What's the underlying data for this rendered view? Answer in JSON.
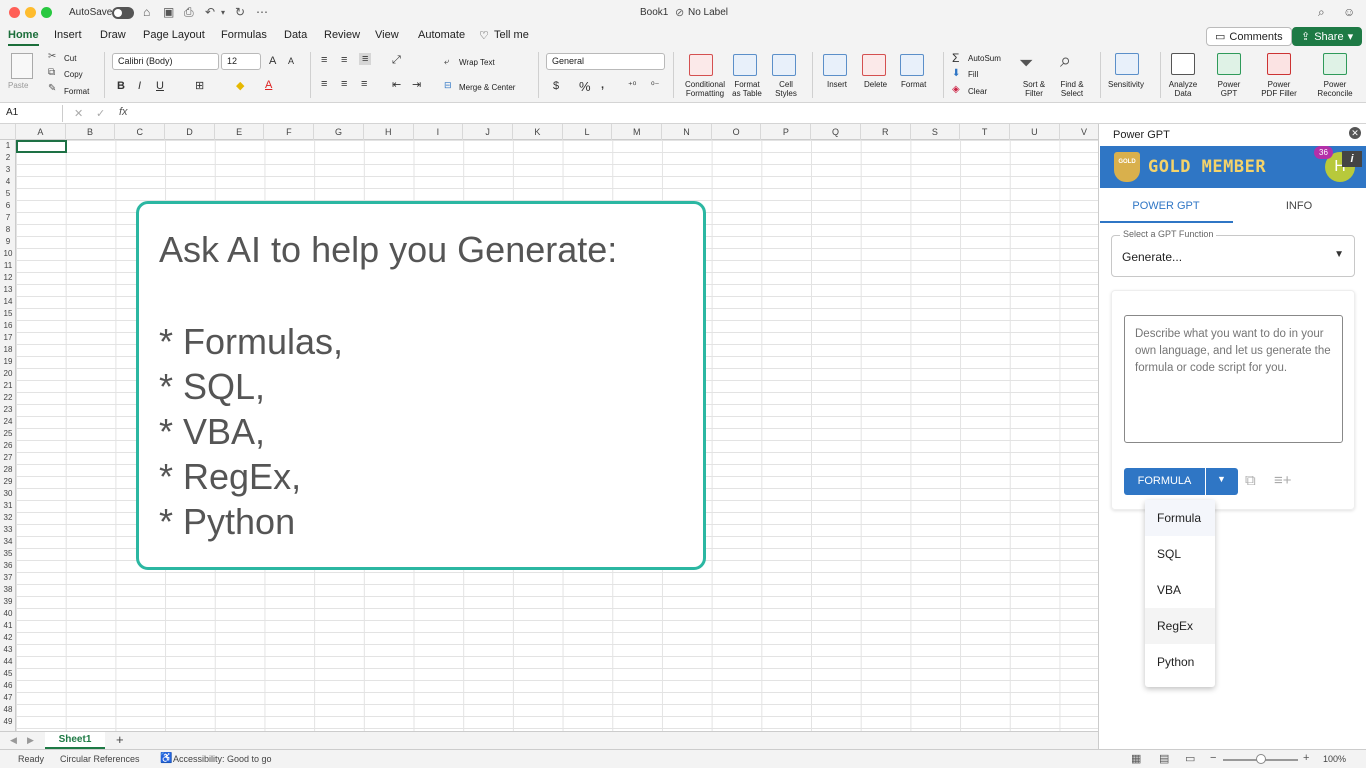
{
  "window": {
    "title": "Book1",
    "label": "No Label",
    "autosave": "AutoSave"
  },
  "colors": {
    "accent_green": "#1b6e3a",
    "brand_blue": "#2f76c5",
    "card_border": "#2bb7a2",
    "gold": "#f4d36a"
  },
  "tabs": [
    {
      "label": "Home"
    },
    {
      "label": "Insert"
    },
    {
      "label": "Draw"
    },
    {
      "label": "Page Layout"
    },
    {
      "label": "Formulas"
    },
    {
      "label": "Data"
    },
    {
      "label": "Review"
    },
    {
      "label": "View"
    },
    {
      "label": "Automate"
    },
    {
      "label": "Tell me"
    }
  ],
  "top_buttons": {
    "comments": "Comments",
    "share": "Share"
  },
  "ribbon": {
    "paste": "Paste",
    "cut": "Cut",
    "copy": "Copy",
    "format": "Format",
    "font_name": "Calibri (Body)",
    "font_size": "12",
    "wrap_text": "Wrap Text",
    "merge_center": "Merge & Center",
    "number_format": "General",
    "conditional_formatting": [
      "Conditional",
      "Formatting"
    ],
    "format_as_table": [
      "Format",
      "as Table"
    ],
    "cell_styles": [
      "Cell",
      "Styles"
    ],
    "insert": "Insert",
    "delete": "Delete",
    "format2": "Format",
    "autosum": "AutoSum",
    "fill": "Fill",
    "clear": "Clear",
    "sort_filter": [
      "Sort &",
      "Filter"
    ],
    "find_select": [
      "Find &",
      "Select"
    ],
    "sensitivity": "Sensitivity",
    "analyze_data": [
      "Analyze",
      "Data"
    ],
    "power_gpt": [
      "Power",
      "GPT"
    ],
    "power_pdf": [
      "Power",
      "PDF Filler"
    ],
    "power_reconcile": [
      "Power",
      "Reconcile"
    ]
  },
  "formula_bar": {
    "name_box": "A1",
    "fx": "fx"
  },
  "columns": [
    "A",
    "B",
    "C",
    "D",
    "E",
    "F",
    "G",
    "H",
    "I",
    "J",
    "K",
    "L",
    "M",
    "N",
    "O",
    "P",
    "Q",
    "R",
    "S",
    "T",
    "U",
    "V"
  ],
  "card": {
    "title": "Ask AI to help you Generate:",
    "items": [
      "* Formulas,",
      "* SQL,",
      "* VBA,",
      "* RegEx,",
      "* Python"
    ]
  },
  "sheet": {
    "name": "Sheet1",
    "add": "+"
  },
  "status": {
    "ready": "Ready",
    "circular": "Circular References",
    "accessibility": "Accessibility: Good to go",
    "zoom": "100%"
  },
  "pane": {
    "title": "Power GPT",
    "banner": "GOLD MEMBER",
    "badge": "36",
    "avatar": "H",
    "info_icon": "i",
    "shield_text": "GOLD",
    "tab_power": "POWER GPT",
    "tab_info": "INFO",
    "select_label": "Select a GPT Function",
    "select_value": "Generate...",
    "textarea_placeholder": "Describe what you want to do in your own language, and let us generate the formula or code script for you.",
    "formula_button": "FORMULA",
    "menu": [
      "Formula",
      "SQL",
      "VBA",
      "RegEx",
      "Python"
    ]
  }
}
